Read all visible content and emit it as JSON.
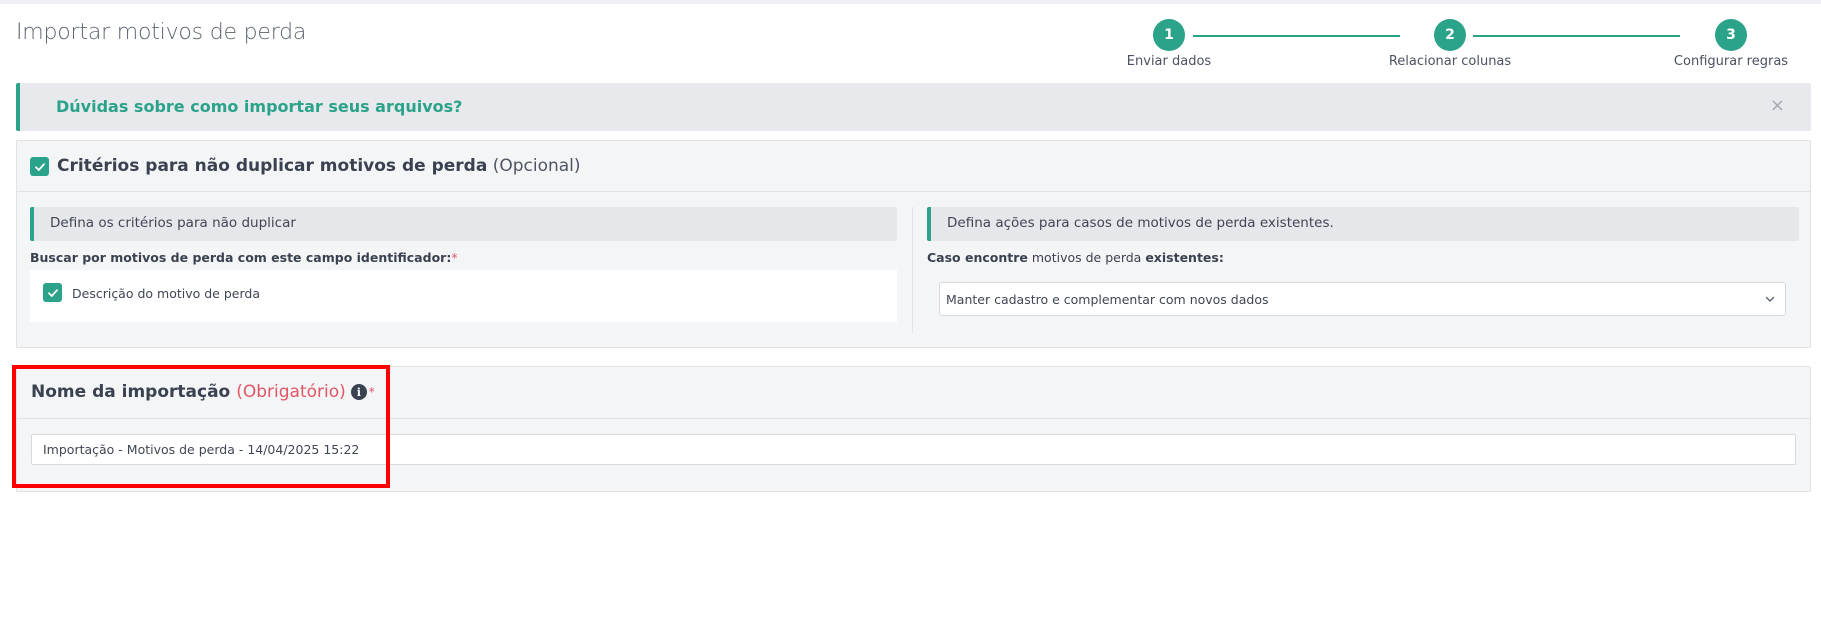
{
  "page": {
    "title": "Importar motivos de perda"
  },
  "stepper": {
    "steps": [
      {
        "number": "1",
        "label": "Enviar dados"
      },
      {
        "number": "2",
        "label": "Relacionar colunas"
      },
      {
        "number": "3",
        "label": "Configurar regras"
      }
    ],
    "color": "#2aa38a"
  },
  "help_banner": {
    "text": "Dúvidas sobre como importar seus arquivos?",
    "close_symbol": "×"
  },
  "criteria_card": {
    "title_bold": "Critérios para não duplicar motivos de perda",
    "title_optional": "(Opcional)",
    "left": {
      "header": "Defina os critérios para não duplicar",
      "label_bold": "Buscar por motivos de perda com este campo identificador:",
      "required_mark": "*",
      "checkbox_label": "Descrição do motivo de perda"
    },
    "right": {
      "header": "Defina ações para casos de motivos de perda existentes.",
      "label_part1": "Caso encontre",
      "label_part2": "motivos de perda",
      "label_part3": "existentes:",
      "select_value": "Manter cadastro e complementar com novos dados"
    }
  },
  "name_card": {
    "title_bold": "Nome da importação",
    "title_required": "(Obrigatório)",
    "info_symbol": "i",
    "required_mark": "*",
    "input_value": "Importação - Motivos de perda - 14/04/2025 15:22"
  },
  "colors": {
    "accent": "#2aa38a",
    "required": "#e25563",
    "highlight": "#ff0000"
  }
}
